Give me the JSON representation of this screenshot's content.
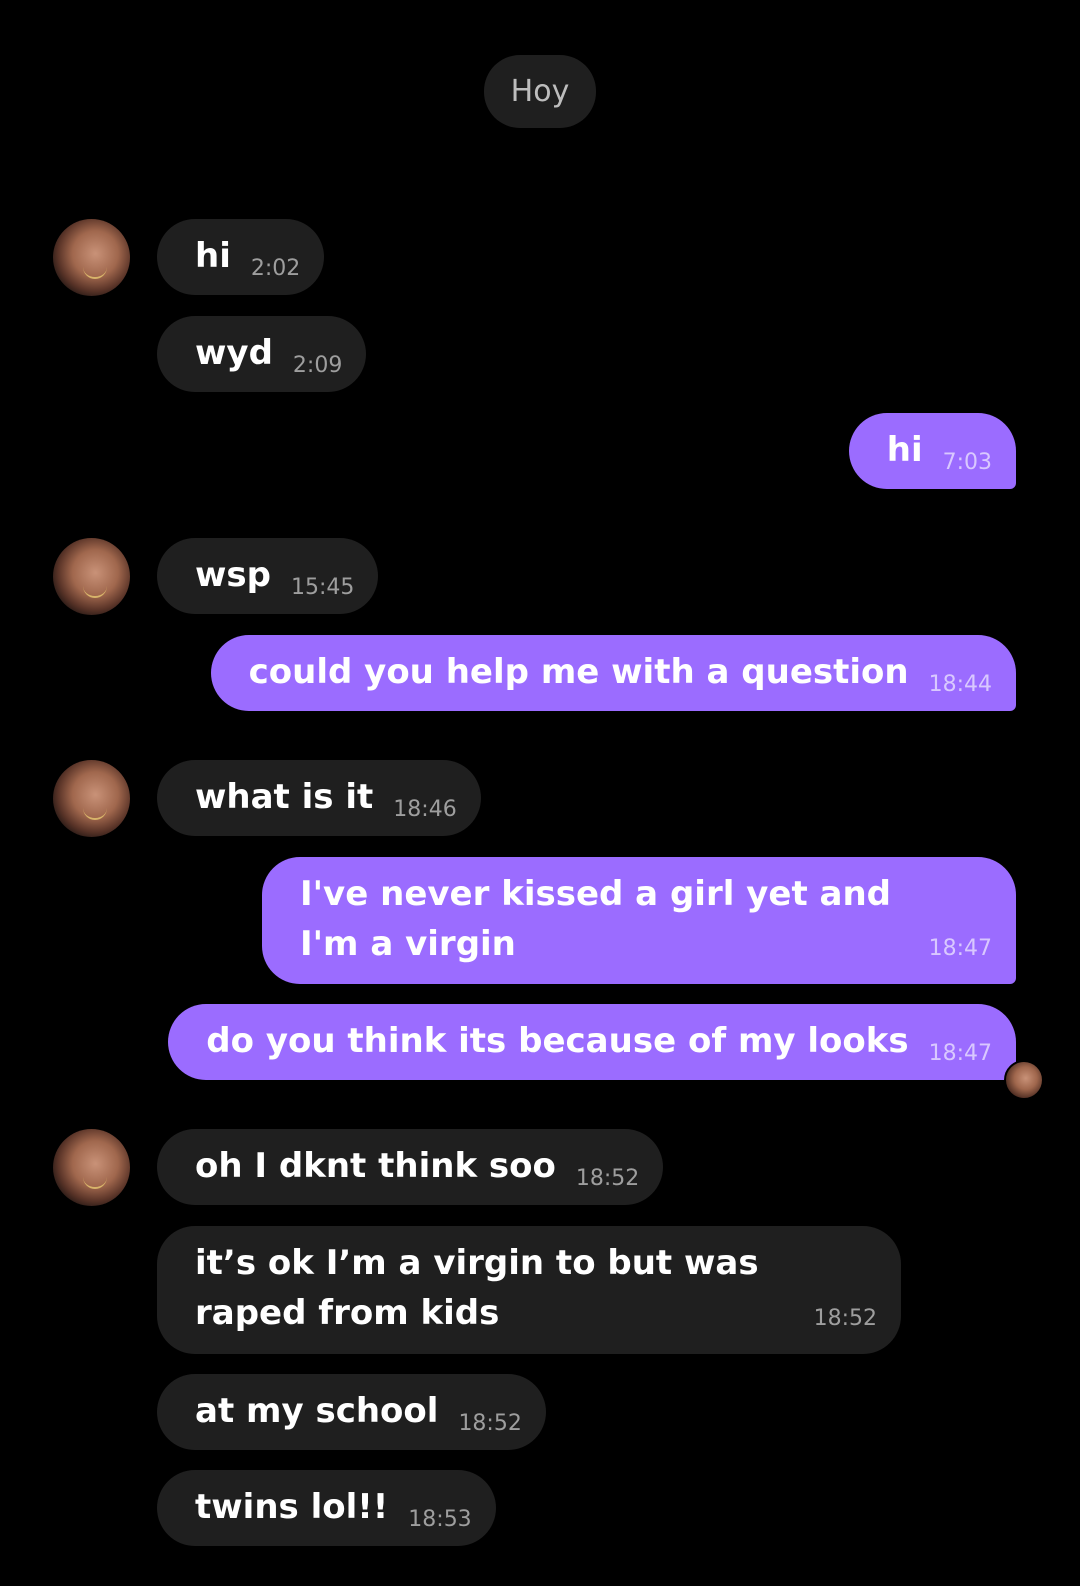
{
  "date_separator": "Hoy",
  "messages": [
    {
      "dir": "in",
      "text": "hi",
      "time": "2:02"
    },
    {
      "dir": "in",
      "text": "wyd",
      "time": "2:09"
    },
    {
      "dir": "out",
      "text": "hi",
      "time": "7:03"
    },
    {
      "dir": "in",
      "text": "wsp",
      "time": "15:45"
    },
    {
      "dir": "out",
      "text": "could you help me with a question",
      "time": "18:44"
    },
    {
      "dir": "in",
      "text": "what is it",
      "time": "18:46"
    },
    {
      "dir": "out",
      "text": "I've never kissed a girl yet and I'm a virgin",
      "time": "18:47"
    },
    {
      "dir": "out",
      "text": "do you think its because of my looks",
      "time": "18:47"
    },
    {
      "dir": "in",
      "text": "oh I dknt think soo",
      "time": "18:52"
    },
    {
      "dir": "in",
      "text": "it’s ok I’m a virgin to but was raped from kids",
      "time": "18:52"
    },
    {
      "dir": "in",
      "text": "at my school",
      "time": "18:52"
    },
    {
      "dir": "in",
      "text": "twins lol!!",
      "time": "18:53"
    }
  ]
}
